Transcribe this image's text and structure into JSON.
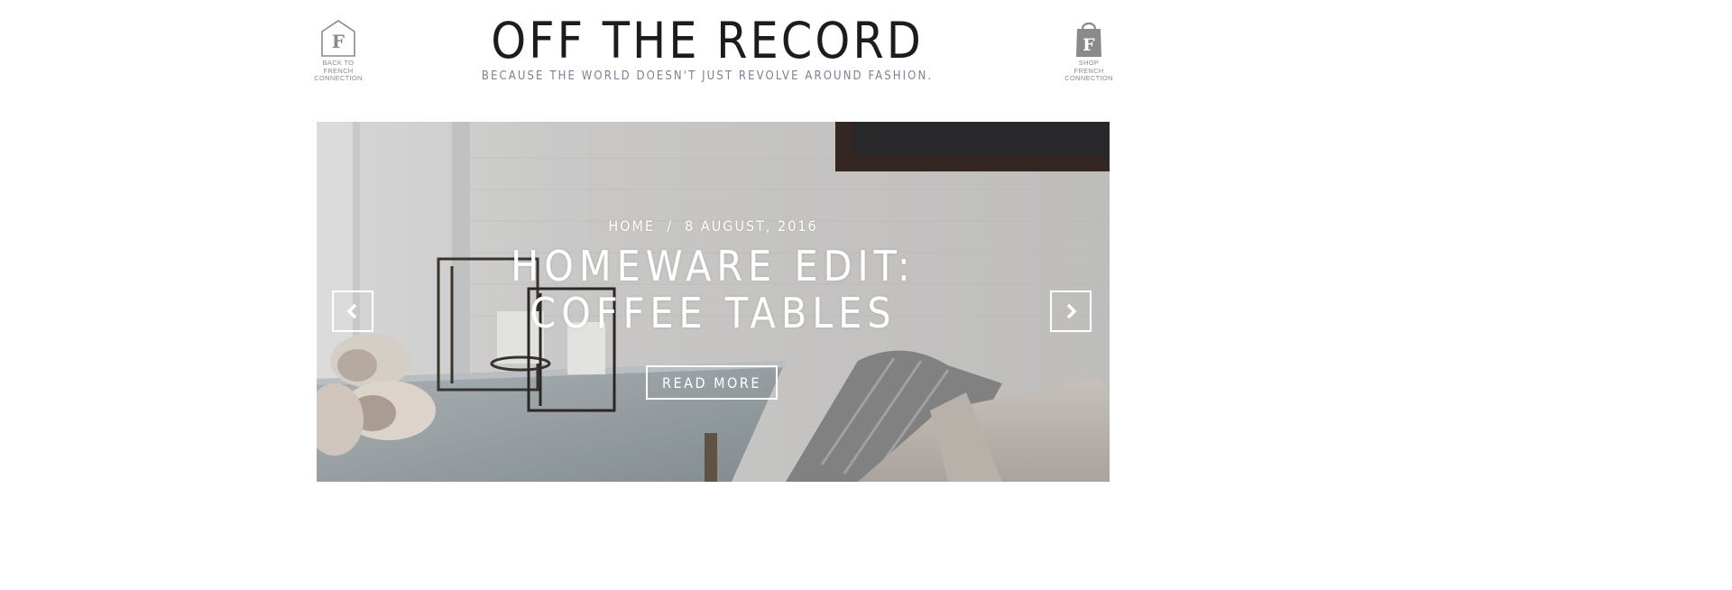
{
  "header": {
    "title": "OFF THE RECORD",
    "tagline": "BECAUSE THE WORLD DOESN'T JUST REVOLVE AROUND FASHION.",
    "back_link": {
      "icon": "house-f-icon",
      "lines": [
        "BACK TO",
        "FRENCH",
        "CONNECTION"
      ]
    },
    "shop_link": {
      "icon": "shopping-bag-f-icon",
      "lines": [
        "SHOP",
        "FRENCH",
        "CONNECTION"
      ]
    }
  },
  "slider": {
    "breadcrumb_home": "HOME",
    "separator": "/",
    "date": "8 AUGUST, 2016",
    "title": "HOMEWARE EDIT: COFFEE TABLES",
    "cta": "READ MORE",
    "prev_icon": "chevron-left-icon",
    "next_icon": "chevron-right-icon"
  },
  "colors": {
    "title": "#1c1c1c",
    "tagline": "#7b8290",
    "icon": "#8a8a8a",
    "overlay_text": "#ffffff"
  }
}
